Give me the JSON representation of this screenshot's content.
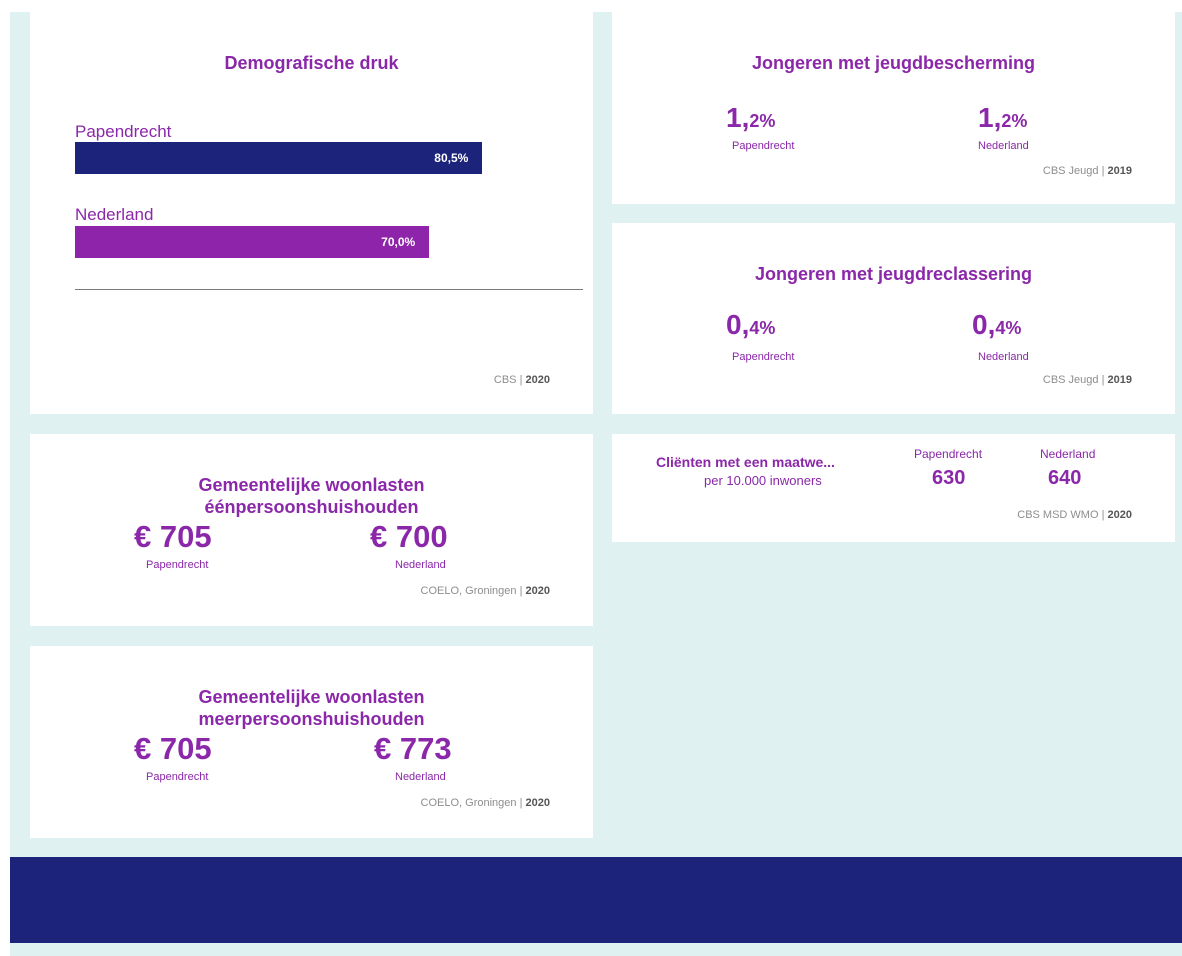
{
  "demografische_druk": {
    "title": "Demografische druk",
    "source": "CBS",
    "source_year": "2020",
    "bars": [
      {
        "label": "Papendrecht",
        "value": 80.5,
        "value_text": "80,5%",
        "color": "#1b237b"
      },
      {
        "label": "Nederland",
        "value": 70.0,
        "value_text": "70,0%",
        "color": "#8e24aa"
      }
    ]
  },
  "jeugdbescherming": {
    "title": "Jongeren met jeugdbescherming",
    "papendrecht_value": "1,",
    "papendrecht_unit": "2%",
    "papendrecht_label": "Papendrecht",
    "nederland_value": "1,",
    "nederland_unit": "2%",
    "nederland_label": "Nederland",
    "source": "CBS Jeugd",
    "source_year": "2019"
  },
  "jeugdreclassering": {
    "title": "Jongeren met jeugdreclassering",
    "papendrecht_value": "0,",
    "papendrecht_unit": "4%",
    "papendrecht_label": "Papendrecht",
    "nederland_value": "0,",
    "nederland_unit": "4%",
    "nederland_label": "Nederland",
    "source": "CBS Jeugd",
    "source_year": "2019"
  },
  "maatwerk": {
    "title": "Cliënten met een maatwe...",
    "subtitle": "per 10.000 inwoners",
    "papendrecht_label": "Papendrecht",
    "papendrecht_value": "630",
    "nederland_label": "Nederland",
    "nederland_value": "640",
    "source": "CBS MSD WMO",
    "source_year": "2020"
  },
  "woonlasten_een": {
    "title_line1": "Gemeentelijke woonlasten",
    "title_line2": "éénpersoonshuishouden",
    "papendrecht_value": "€ 705",
    "papendrecht_label": "Papendrecht",
    "nederland_value": "€ 700",
    "nederland_label": "Nederland",
    "source": "COELO, Groningen",
    "source_year": "2020"
  },
  "woonlasten_meer": {
    "title_line1": "Gemeentelijke woonlasten",
    "title_line2": "meerpersoonshuishouden",
    "papendrecht_value": "€ 705",
    "papendrecht_label": "Papendrecht",
    "nederland_value": "€ 773",
    "nederland_label": "Nederland",
    "source": "COELO, Groningen",
    "source_year": "2020"
  },
  "colors": {
    "purple": "#8b27a9",
    "navy": "#1b237b",
    "background": "#dff1f1"
  }
}
